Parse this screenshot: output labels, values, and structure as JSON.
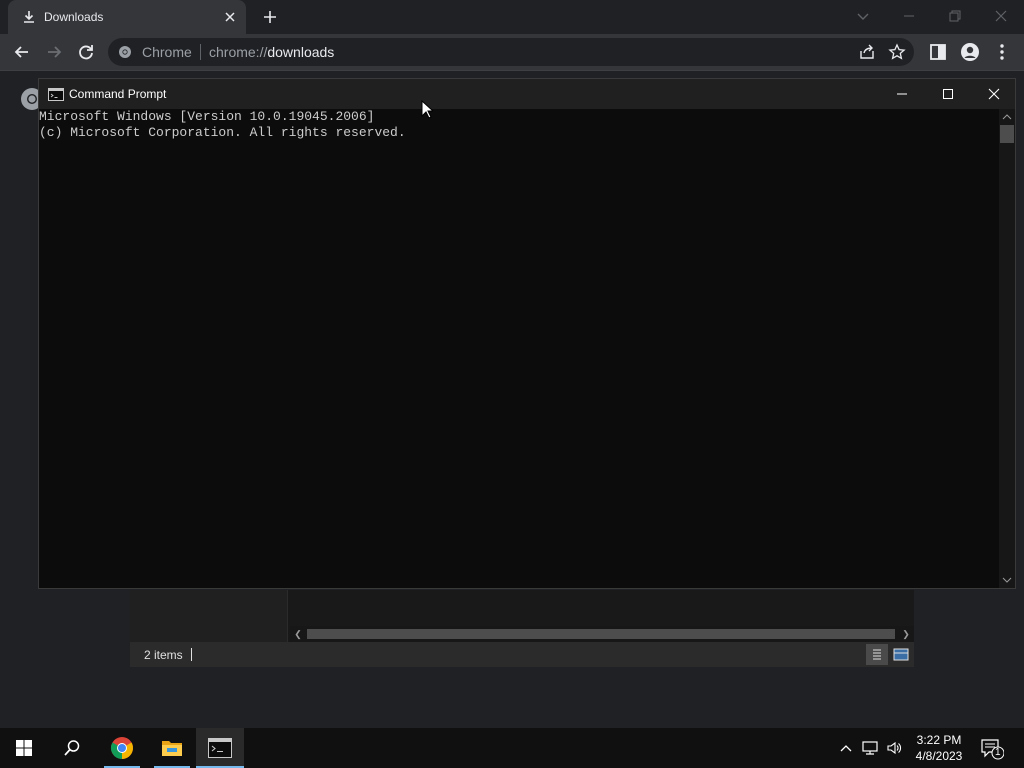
{
  "chrome": {
    "tab": {
      "title": "Downloads",
      "icon": "download-icon",
      "close": "close-icon"
    },
    "new_tab_icon": "plus-icon",
    "window_controls": [
      "chevron-down-icon",
      "minimize-icon",
      "restore-icon",
      "close-icon"
    ],
    "toolbar": {
      "back_icon": "back-arrow-icon",
      "forward_icon": "forward-arrow-icon",
      "reload_icon": "reload-icon",
      "site_name": "Chrome",
      "url_scheme": "chrome://",
      "url_path": "downloads",
      "share_icon": "share-icon",
      "bookmark_icon": "star-icon",
      "side_panel_icon": "side-panel-icon",
      "profile_icon": "profile-icon",
      "menu_icon": "kebab-menu-icon"
    }
  },
  "explorer": {
    "status_count": "2 items",
    "view_buttons": [
      "details-view-icon",
      "tiles-view-icon"
    ]
  },
  "cmd": {
    "title": "Command Prompt",
    "lines": [
      "Microsoft Windows [Version 10.0.19045.2006]",
      "(c) Microsoft Corporation. All rights reserved."
    ],
    "controls": [
      "minimize-icon",
      "maximize-icon",
      "close-icon"
    ]
  },
  "taskbar": {
    "apps": [
      "windows-start-icon",
      "search-icon",
      "chrome-icon",
      "file-explorer-icon",
      "command-prompt-icon"
    ],
    "tray": [
      "chevron-up-icon",
      "network-icon",
      "volume-icon"
    ],
    "time": "3:22 PM",
    "date": "4/8/2023",
    "notification_count": "1"
  },
  "colors": {
    "accent": "#76b9ed",
    "chrome_frame": "#202124",
    "chrome_toolbar": "#35363a",
    "console_bg": "#0c0c0c",
    "console_text": "#cccccc"
  }
}
